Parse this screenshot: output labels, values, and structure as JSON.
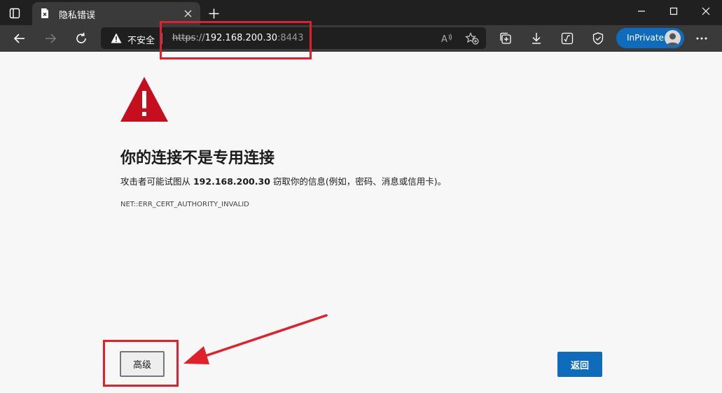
{
  "browser": {
    "tab": {
      "title": "隐私错误"
    },
    "window_controls": [
      "minimize",
      "maximize",
      "close"
    ],
    "address_bar": {
      "security_label": "不安全",
      "url_scheme": "https",
      "url_separator": "://",
      "url_host": "192.168.200.30",
      "url_port": ":8443"
    },
    "inprivate_label": "InPrivate"
  },
  "page": {
    "heading": "你的连接不是专用连接",
    "description_prefix": "攻击者可能试图从 ",
    "description_host": "192.168.200.30",
    "description_suffix": " 窃取你的信息(例如，密码、消息或信用卡)。",
    "error_code": "NET::ERR_CERT_AUTHORITY_INVALID",
    "advanced_button": "高级",
    "back_button": "返回"
  },
  "colors": {
    "warning_red": "#c50f1f",
    "annotation_red": "#e0202a",
    "accent_blue": "#0f6cbd"
  }
}
